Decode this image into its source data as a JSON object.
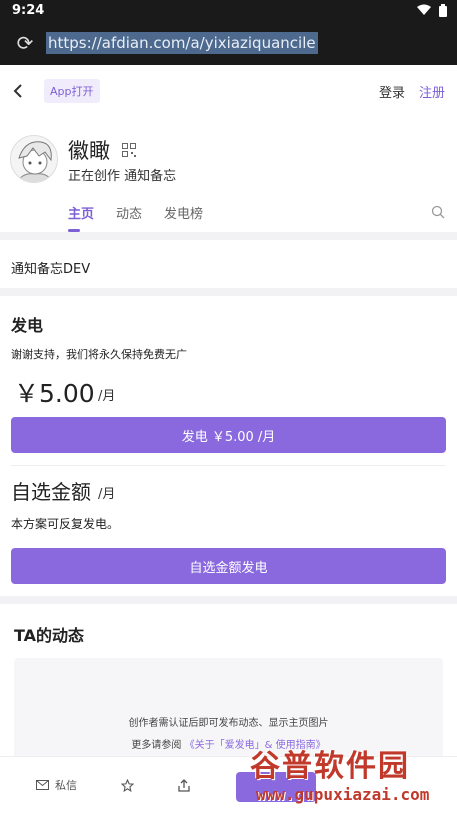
{
  "status_bar": {
    "time": "9:24"
  },
  "browser": {
    "url": "https://afdian.com/a/yixiaziquancile"
  },
  "topnav": {
    "app_open": "App打开",
    "login": "登录",
    "register": "注册"
  },
  "profile": {
    "name": "徽瞰",
    "description": "正在创作 通知备忘",
    "tabs": [
      "主页",
      "动态",
      "发电榜"
    ]
  },
  "intro": {
    "text": "通知备忘DEV"
  },
  "power": {
    "title": "发电",
    "thanks": "谢谢支持，我们将永久保持免费无广",
    "price": "￥5.00",
    "price_unit": "/月",
    "button_label": "发电 ￥5.00 /月",
    "custom_title": "自选金额",
    "custom_unit": "/月",
    "repeat_note": "本方案可反复发电。",
    "custom_button_label": "自选金额发电"
  },
  "feed": {
    "title": "TA的动态",
    "msg1": "创作者需认证后即可发布动态、显示主页图片",
    "msg2_prefix": "更多请参阅",
    "msg2_link": "《关于「爱发电」& 使用指南》"
  },
  "bottombar": {
    "message": "私信"
  },
  "watermark": {
    "top": "谷普软件园",
    "bottom": "www.gupuxiazai.com"
  },
  "colors": {
    "accent": "#7d5fd6",
    "button": "#8a69df"
  }
}
